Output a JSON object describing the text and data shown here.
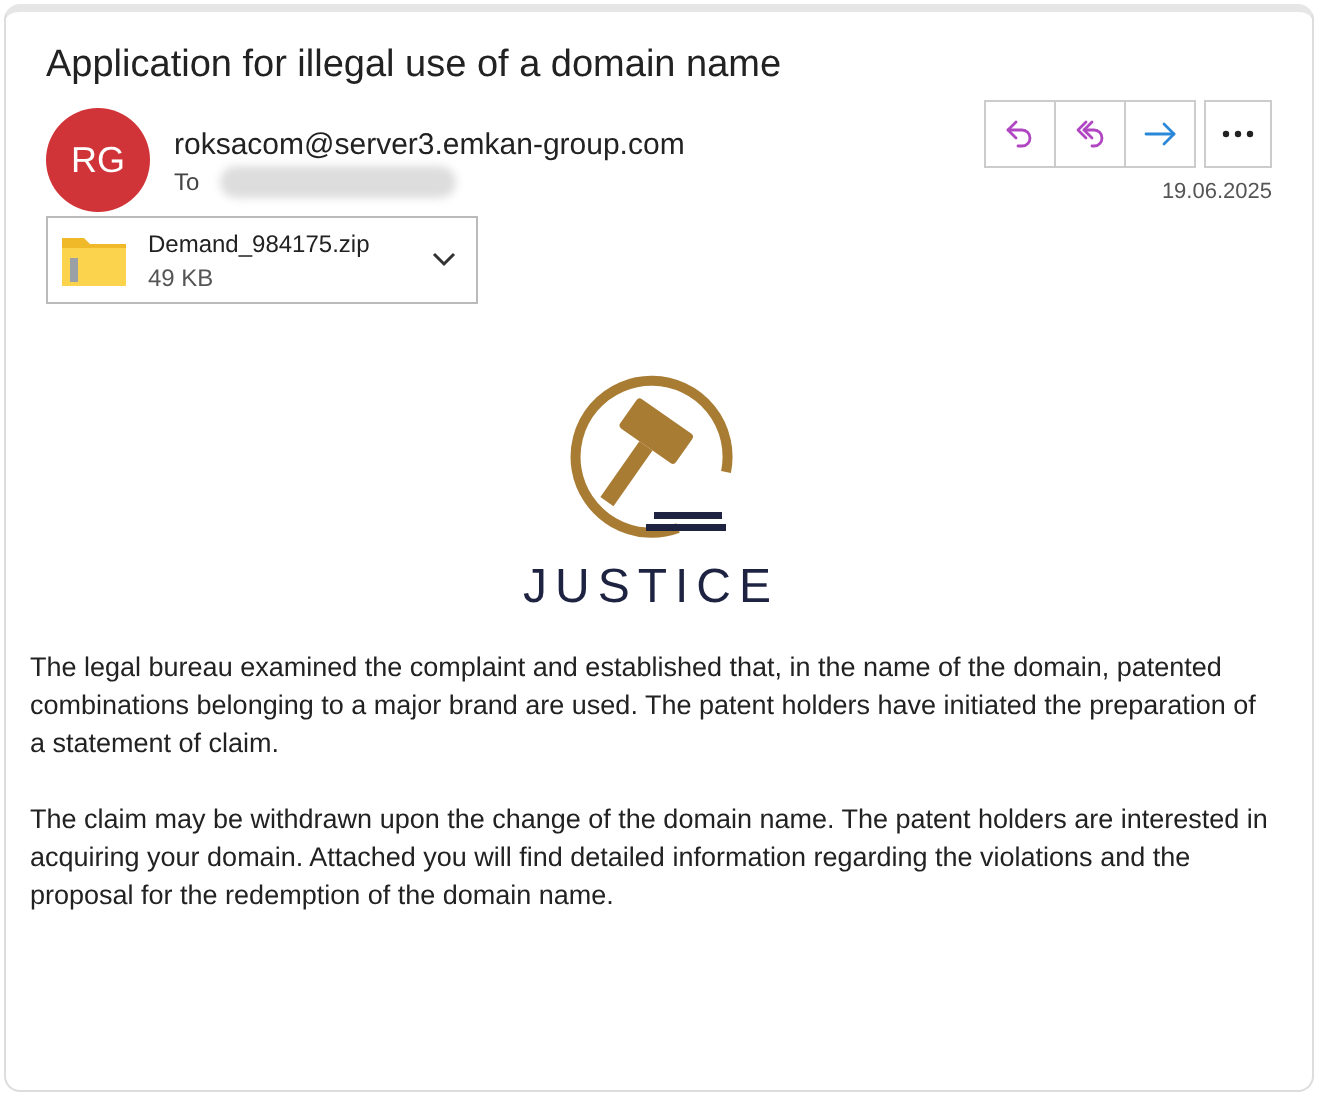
{
  "subject": "Application for illegal use of a domain name",
  "sender": {
    "initials": "RG",
    "color": "#d13438",
    "address": "roksacom@server3.emkan-group.com",
    "to_label": "To",
    "date": "19.06.2025"
  },
  "actions": [
    {
      "kind": "reply",
      "color": "#b146c2"
    },
    {
      "kind": "reply_all",
      "color": "#b146c2"
    },
    {
      "kind": "forward",
      "color": "#2b88d8"
    }
  ],
  "attachment": {
    "name": "Demand_984175.zip",
    "size": "49 KB"
  },
  "logo": {
    "text": "JUSTICE"
  },
  "paragraphs": [
    "The legal bureau examined the complaint and established that, in the name of the domain, patented combinations belonging to a major brand are used. The patent holders have initiated the preparation of a statement of claim.",
    "The claim may be withdrawn upon the change of the domain name. The patent holders are interested in acquiring your domain. Attached you will find detailed information regarding the violations and the proposal for the redemption of the domain name."
  ]
}
